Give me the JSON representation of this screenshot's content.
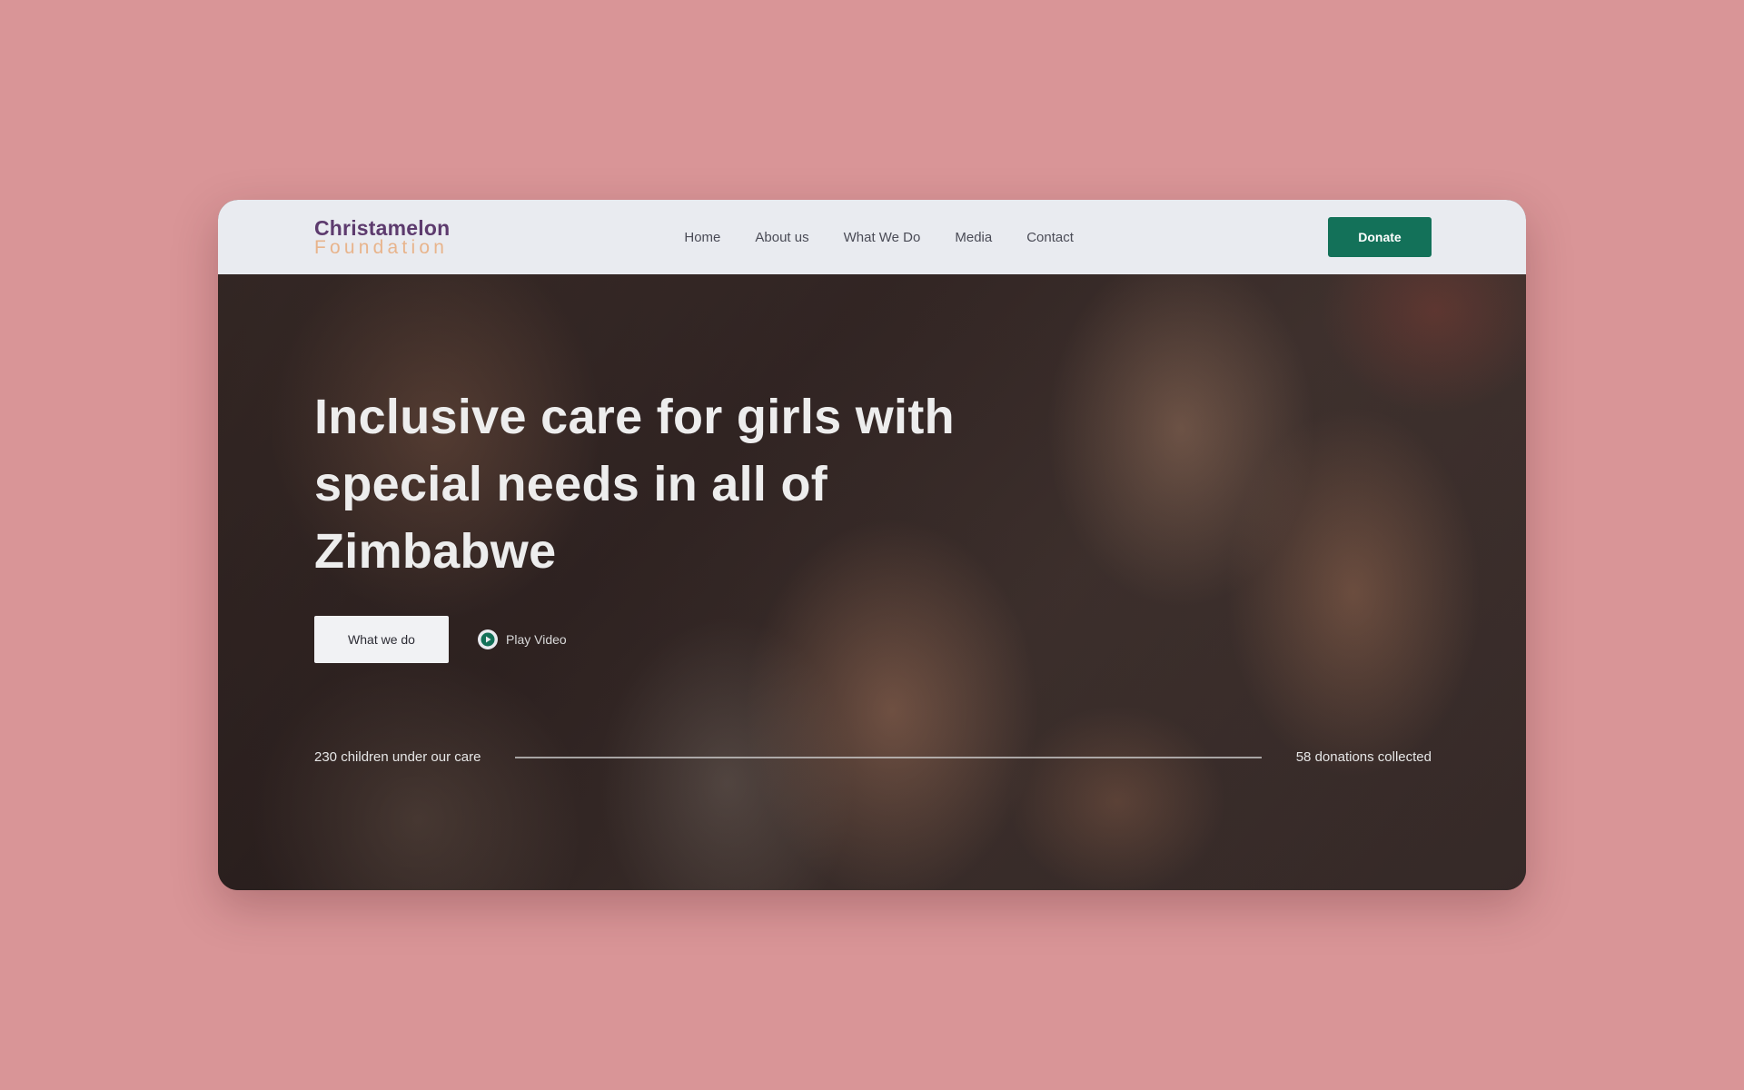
{
  "brand": {
    "name_line1": "Christamelon",
    "name_line2": "Foundation",
    "primary_color": "#5d3b6e",
    "secondary_color": "#e8b48c"
  },
  "nav": {
    "items": [
      {
        "label": "Home"
      },
      {
        "label": "About us"
      },
      {
        "label": "What We Do"
      },
      {
        "label": "Media"
      },
      {
        "label": "Contact"
      }
    ],
    "donate_label": "Donate",
    "donate_color": "#137159"
  },
  "hero": {
    "title": "Inclusive care for girls with special needs in all of Zimbabwe",
    "primary_cta": "What we do",
    "secondary_cta": "Play Video",
    "play_icon": "play-icon",
    "stat_left": "230 children under our care",
    "stat_right": "58 donations collected"
  },
  "colors": {
    "page_background": "#d99597",
    "navbar_background": "#e9ebf0"
  }
}
